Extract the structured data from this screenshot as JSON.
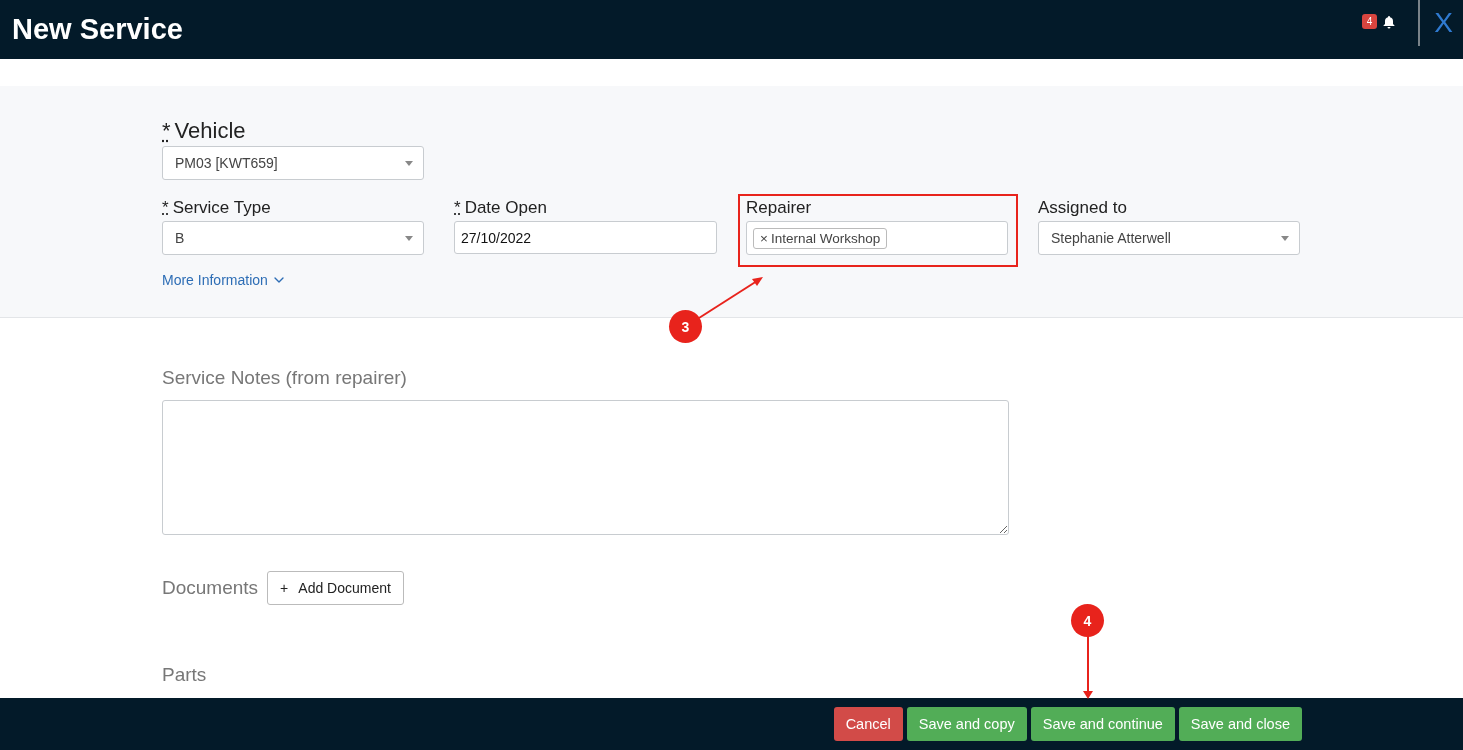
{
  "header": {
    "title": "New Service",
    "notification_count": "4",
    "close_label": "X"
  },
  "vehicle": {
    "required_mark": "*",
    "label": "Vehicle",
    "kind": "select",
    "value": "PM03 [KWT659]"
  },
  "fields": [
    {
      "required_mark": "*",
      "label": "Service Type",
      "kind": "select",
      "value": "B",
      "highlighted": false
    },
    {
      "required_mark": "*",
      "label": "Date Open",
      "kind": "input",
      "value": "27/10/2022",
      "highlighted": false
    },
    {
      "label": "Repairer",
      "kind": "tags",
      "tags": [
        "Internal Workshop"
      ],
      "tag_remove": "×",
      "highlighted": true
    },
    {
      "label": "Assigned to",
      "kind": "select",
      "value": "Stephanie Atterwell",
      "highlighted": false
    }
  ],
  "more_information": "More Information",
  "service_notes": {
    "label": "Service Notes (from repairer)"
  },
  "documents": {
    "label": "Documents",
    "button_icon": "+",
    "button": "Add Document"
  },
  "parts": {
    "label": "Parts"
  },
  "footer_buttons": [
    {
      "label": "Cancel",
      "kind": "danger"
    },
    {
      "label": "Save and copy",
      "kind": "success"
    },
    {
      "label": "Save and continue",
      "kind": "success"
    },
    {
      "label": "Save and close",
      "kind": "success"
    }
  ],
  "annotations": [
    {
      "label": "3",
      "kind": "diagonal"
    },
    {
      "label": "4",
      "kind": "vertical"
    }
  ]
}
